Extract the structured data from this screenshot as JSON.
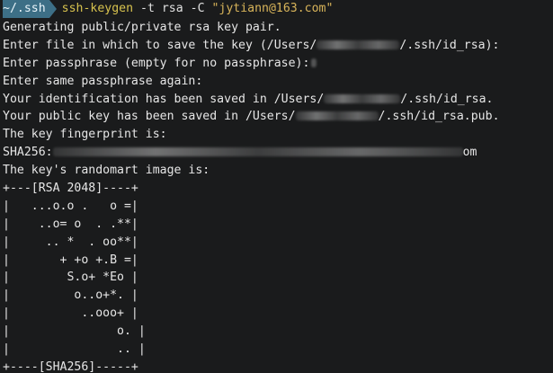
{
  "prompt": {
    "path": "~/.ssh",
    "command": "ssh-keygen",
    "flag_t": "-t",
    "flag_t_value": "rsa",
    "flag_c": "-C",
    "comment": "\"jytiann@163.com\""
  },
  "output": {
    "l1": "Generating public/private rsa key pair.",
    "l2a": "Enter file in which to save the key (/Users/",
    "l2b": "/.ssh/id_rsa):",
    "l3": "Enter passphrase (empty for no passphrase):",
    "l4": "Enter same passphrase again:",
    "l5a": "Your identification has been saved in /Users/",
    "l5b": "/.ssh/id_rsa.",
    "l6a": "Your public key has been saved in /Users/",
    "l6b": "/.ssh/id_rsa.pub.",
    "l7": "The key fingerprint is:",
    "l8a": "SHA256:",
    "l8b": "om",
    "l9": "The key's randomart image is:"
  },
  "randomart": [
    "+---[RSA 2048]----+",
    "|   ...o.o .   o =|",
    "|    ..o= o  . .**|",
    "|     .. *  . oo**|",
    "|       + +o +.B =|",
    "|        S.o+ *Eo |",
    "|         o..o+*. |",
    "|          ..ooo+ |",
    "|               o. |",
    "|               .. |",
    "+----[SHA256]-----+"
  ]
}
